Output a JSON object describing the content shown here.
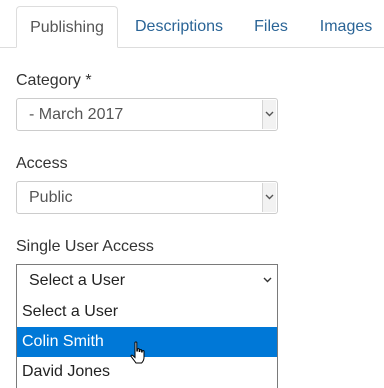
{
  "tabs": [
    {
      "label": "Publishing",
      "active": true
    },
    {
      "label": "Descriptions",
      "active": false
    },
    {
      "label": "Files",
      "active": false
    },
    {
      "label": "Images",
      "active": false
    }
  ],
  "fields": {
    "category": {
      "label": "Category *",
      "value": "- March 2017"
    },
    "access": {
      "label": "Access",
      "value": "Public"
    },
    "single_user_access": {
      "label": "Single User Access",
      "value": "Select a User",
      "options": [
        "Select a User",
        "Colin Smith",
        "David Jones"
      ],
      "highlighted": "Colin Smith"
    }
  },
  "colors": {
    "highlight": "#0078d7",
    "link": "#2a6496"
  },
  "icons": {
    "dropdown": "chevron-down-icon",
    "cursor": "hand-pointer-icon"
  }
}
